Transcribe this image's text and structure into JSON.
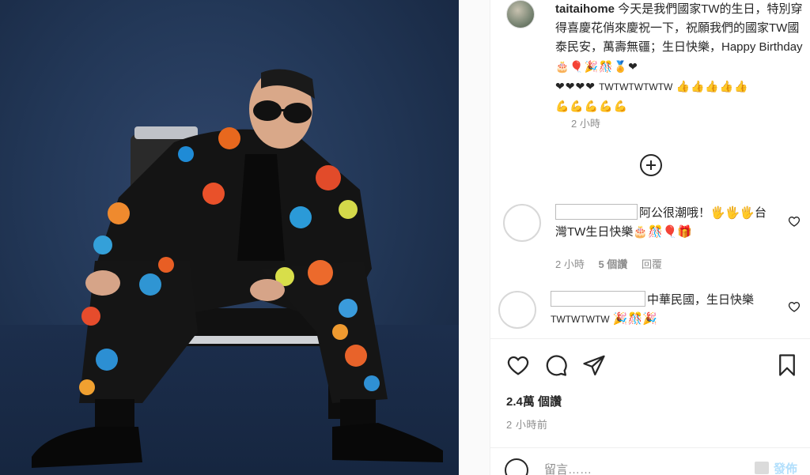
{
  "post": {
    "username": "taitaihome",
    "caption": "今天是我們國家TW的生日，特別穿得喜慶花俏來慶祝一下，祝願我們的國家TW國泰民安，萬壽無疆；生日快樂，Happy Birthday",
    "caption_emoji_1": "🎂🎈🎉🎊🏅❤",
    "caption_emoji_2": "❤❤❤❤",
    "caption_tw_1": "TWTWTWTWTW",
    "caption_emoji_3": "👍👍👍👍👍",
    "caption_emoji_4": "💪💪💪💪💪",
    "time": "2 小時"
  },
  "comments": [
    {
      "text": "阿公很潮哦！🖐🖐🖐台灣TW生日快樂🎂🎊🎈🎁",
      "time": "2 小時",
      "likes": "5 個讚",
      "reply": "回覆"
    },
    {
      "text": "中華民國，生日快樂",
      "text_tw": "TWTWTWTW",
      "text_emoji": "🎉🎊🎉",
      "time": "",
      "likes": "",
      "reply": ""
    }
  ],
  "stats": {
    "likes": "2.4萬 個讚",
    "posted": "2 小時前"
  },
  "composer": {
    "placeholder": "留言……",
    "post_label": "發佈"
  },
  "colors": {
    "text": "#262626",
    "meta": "#8e8e8e",
    "post_disabled": "#b2dffc",
    "photo_background": "#233858"
  },
  "icons": [
    "heart-icon",
    "comment-icon",
    "share-icon",
    "bookmark-icon",
    "plus-circle-icon",
    "emoji-icon"
  ]
}
